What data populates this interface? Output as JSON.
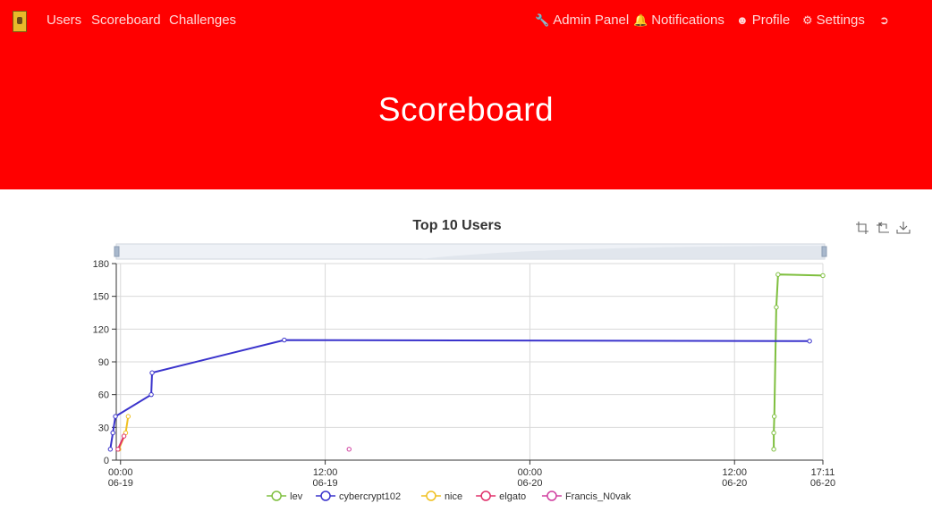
{
  "nav": {
    "logo_icon": "ctf-logo-icon",
    "left": [
      {
        "label": "Users"
      },
      {
        "label": "Scoreboard"
      },
      {
        "label": "Challenges"
      }
    ],
    "right": [
      {
        "label": "Admin Panel",
        "icon": "wrench-icon"
      },
      {
        "label": "Notifications",
        "icon": "bell-icon"
      },
      {
        "label": "Profile",
        "icon": "user-circle-icon"
      },
      {
        "label": "Settings",
        "icon": "gears-icon"
      },
      {
        "label": "",
        "icon": "logout-icon"
      }
    ]
  },
  "hero": {
    "title": "Scoreboard",
    "background": "#ff0000"
  },
  "chart_data": {
    "type": "line",
    "title": "Top 10 Users",
    "xlabel": "",
    "ylabel": "",
    "ylim": [
      0,
      180
    ],
    "yticks": [
      "0",
      "30",
      "60",
      "90",
      "120",
      "150",
      "180"
    ],
    "xlim_hours": [
      -0.25,
      41.18
    ],
    "xticks": [
      {
        "t": 0,
        "time": "00:00",
        "date": "06-19"
      },
      {
        "t": 12,
        "time": "12:00",
        "date": "06-19"
      },
      {
        "t": 24,
        "time": "00:00",
        "date": "06-20"
      },
      {
        "t": 36,
        "time": "12:00",
        "date": "06-20"
      },
      {
        "t": 41.18,
        "time": "17:11",
        "date": "06-20"
      }
    ],
    "legend_position": "bottom",
    "grid": true,
    "series": [
      {
        "name": "lev",
        "color": "#7fbf3f",
        "points": [
          [
            38.3,
            10
          ],
          [
            38.3,
            25
          ],
          [
            38.33,
            40
          ],
          [
            38.45,
            140
          ],
          [
            38.55,
            170
          ],
          [
            41.18,
            169
          ]
        ]
      },
      {
        "name": "cybercrypt102",
        "color": "#3a33cc",
        "points": [
          [
            -0.6,
            10
          ],
          [
            -0.45,
            25
          ],
          [
            -0.3,
            40
          ],
          [
            1.8,
            60
          ],
          [
            1.85,
            80
          ],
          [
            9.6,
            110
          ],
          [
            40.4,
            109
          ]
        ]
      },
      {
        "name": "nice",
        "color": "#f0c020",
        "points": [
          [
            -0.1,
            10
          ],
          [
            0.3,
            25
          ],
          [
            0.45,
            40
          ]
        ]
      },
      {
        "name": "elgato",
        "color": "#e0306a",
        "points": [
          [
            -0.15,
            10
          ],
          [
            0.2,
            22
          ]
        ]
      },
      {
        "name": "Francis_N0vak",
        "color": "#d040a0",
        "points": [
          [
            13.4,
            10
          ]
        ]
      }
    ]
  },
  "toolbar": {
    "icons": [
      "zoom-select-icon",
      "zoom-reset-icon",
      "download-icon"
    ]
  }
}
